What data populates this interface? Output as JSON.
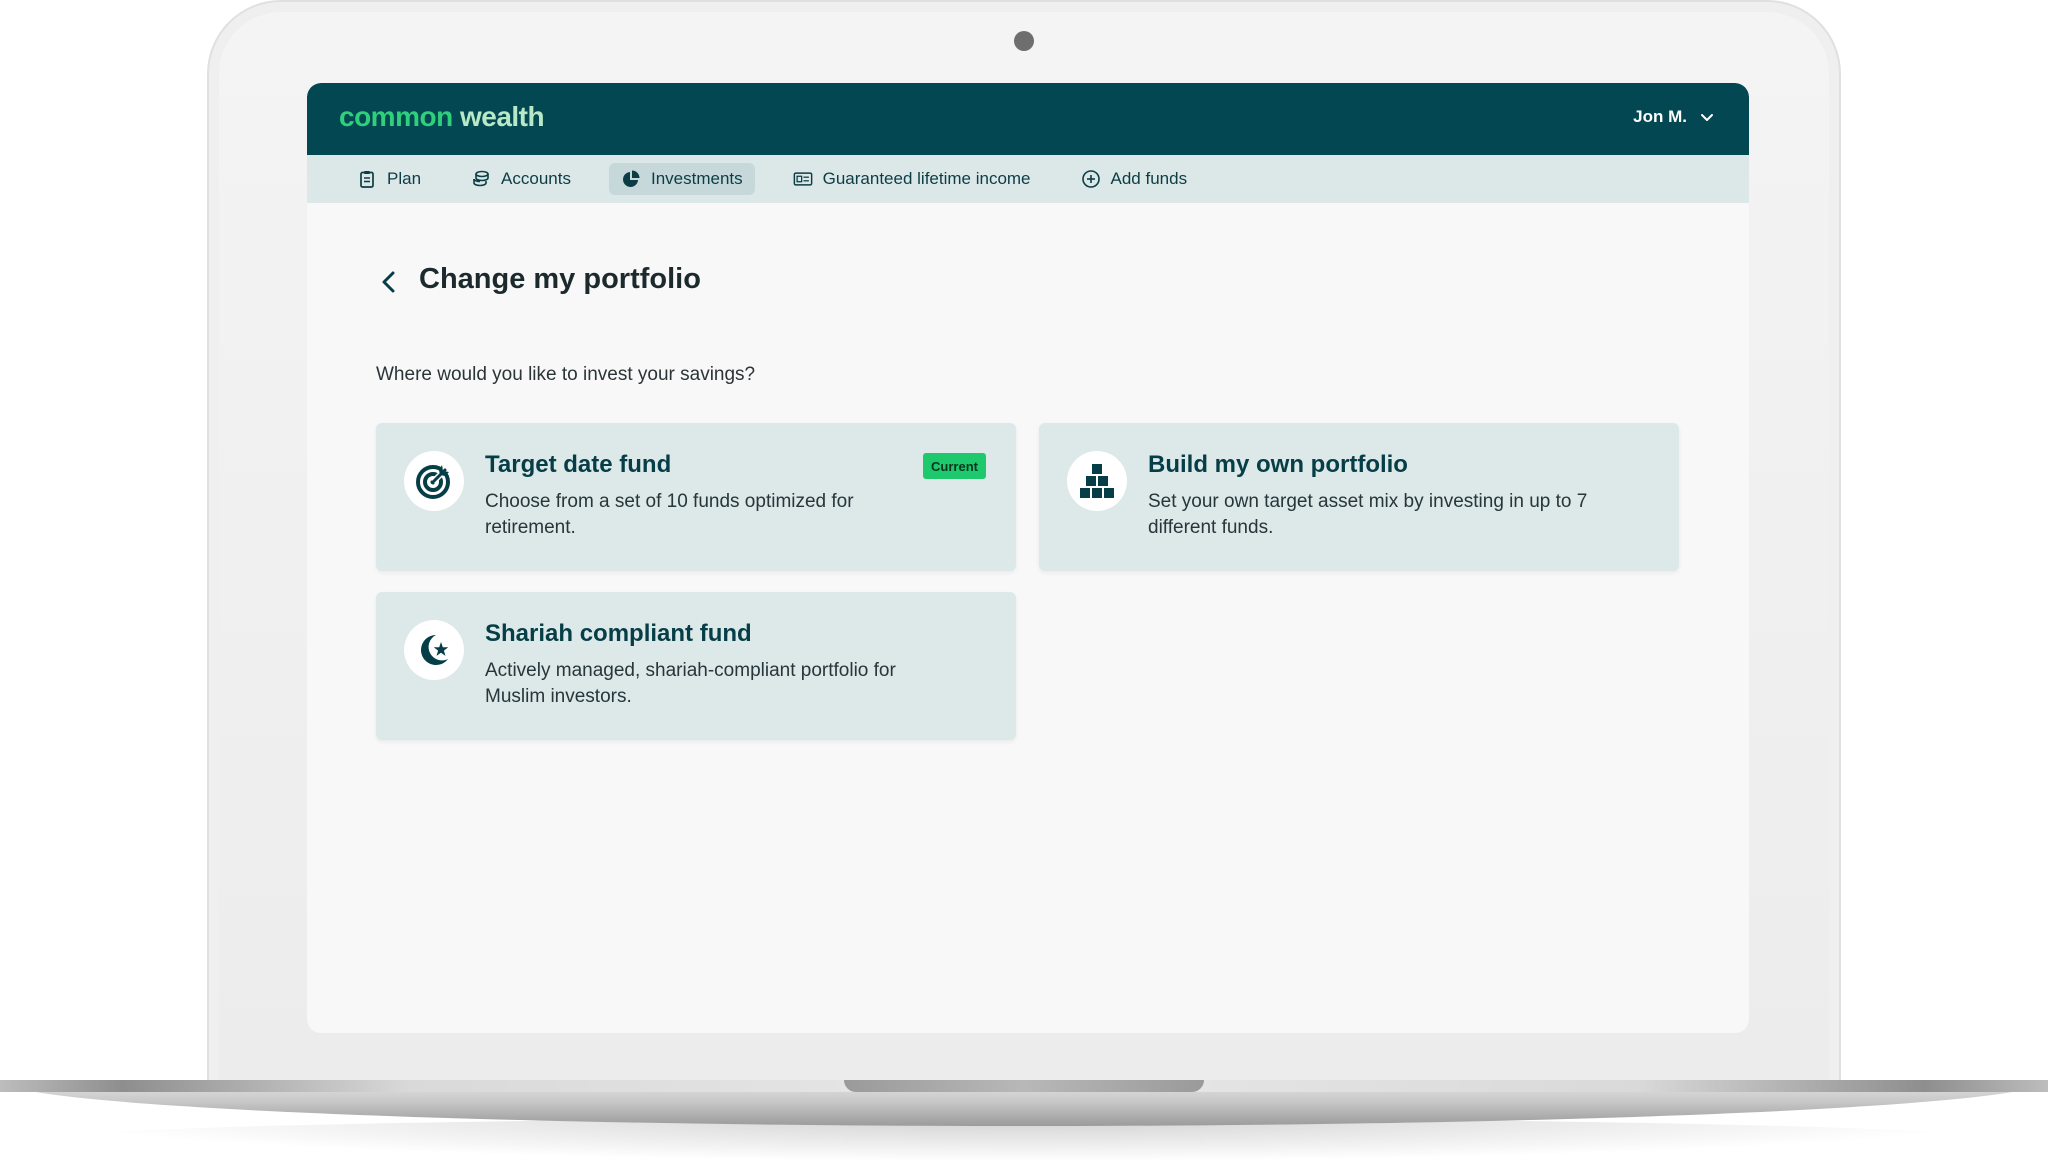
{
  "colors": {
    "brand_dark": "#034752",
    "brand_green": "#2fd07b",
    "nav_bg": "#dce7e8",
    "card_bg": "#dde8e9",
    "badge_green": "#1ec96e"
  },
  "header": {
    "logo_part1": "common",
    "logo_part2": " wealth",
    "user_name": "Jon M.",
    "user_icon": "chevron-down-icon"
  },
  "nav": {
    "items": [
      {
        "label": "Plan",
        "icon": "clipboard-icon",
        "active": false
      },
      {
        "label": "Accounts",
        "icon": "coins-stack-icon",
        "active": false
      },
      {
        "label": "Investments",
        "icon": "pie-chart-icon",
        "active": true
      },
      {
        "label": "Guaranteed lifetime income",
        "icon": "id-card-icon",
        "active": false
      },
      {
        "label": "Add funds",
        "icon": "plus-circle-icon",
        "active": false
      }
    ]
  },
  "page": {
    "title": "Change my portfolio",
    "question": "Where would you like to invest your savings?"
  },
  "cards": [
    {
      "title": "Target date fund",
      "description": "Choose from a set of 10 funds optimized for retirement.",
      "badge": "Current",
      "icon": "target-icon"
    },
    {
      "title": "Build my own portfolio",
      "description": "Set your own target asset mix by investing in up to 7 different funds.",
      "icon": "blocks-icon"
    },
    {
      "title": "Shariah compliant fund",
      "description": "Actively managed, shariah-compliant portfolio for Muslim investors.",
      "icon": "crescent-star-icon"
    }
  ]
}
